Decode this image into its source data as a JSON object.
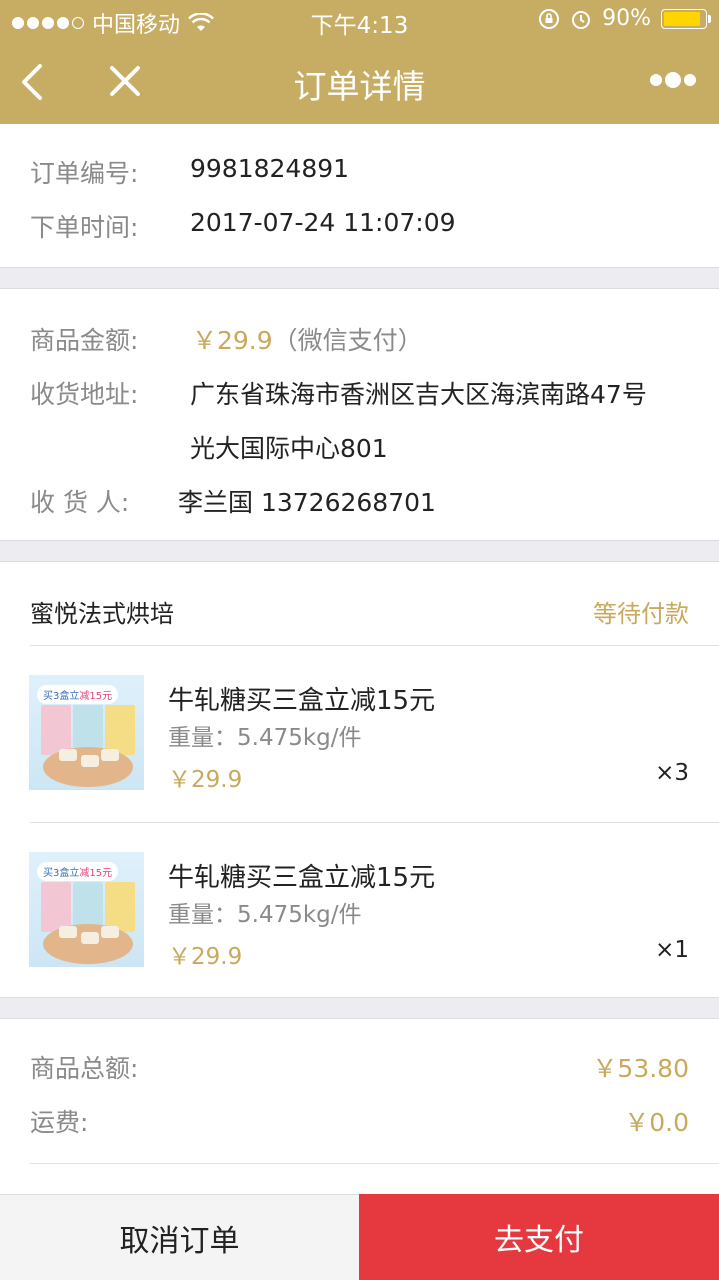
{
  "status_bar": {
    "carrier": "中国移动",
    "time": "下午4:13",
    "battery": "90%",
    "battery_level": 0.9
  },
  "nav": {
    "title": "订单详情",
    "back_icon": "chevron-left-icon",
    "close_icon": "close-icon",
    "more_icon": "more-dots-icon"
  },
  "order_info": {
    "number_label": "订单编号:",
    "number": "9981824891",
    "time_label": "下单时间:",
    "time": "2017-07-24 11:07:09"
  },
  "delivery": {
    "amount_label": "商品金额:",
    "amount": "￥29.9",
    "pay_method": "（微信支付）",
    "address_label": "收货地址:",
    "address_line1": "广东省珠海市香洲区吉大区海滨南路47号",
    "address_line2": "光大国际中心801",
    "receiver_label": "收 货 人:",
    "receiver": "李兰国 13726268701"
  },
  "shop": {
    "name": "蜜悦法式烘培",
    "status": "等待付款",
    "items": [
      {
        "title": "牛轧糖买三盒立减15元",
        "weight": "重量：5.475kg/件",
        "price": "￥29.9",
        "qty": "×3",
        "thumb_banner_a": "买3盒立",
        "thumb_banner_b": "减15元"
      },
      {
        "title": "牛轧糖买三盒立减15元",
        "weight": "重量：5.475kg/件",
        "price": "￥29.9",
        "qty": "×1",
        "thumb_banner_a": "买3盒立",
        "thumb_banner_b": "减15元"
      }
    ]
  },
  "summary": {
    "total_label": "商品总额:",
    "total": "￥53.80",
    "shipping_label": "运费:",
    "shipping": "￥0.0"
  },
  "actions": {
    "cancel": "取消订单",
    "pay": "去支付"
  },
  "colors": {
    "brand": "#c7ad64",
    "price": "#c9a95c",
    "pay_button": "#e5393f"
  }
}
